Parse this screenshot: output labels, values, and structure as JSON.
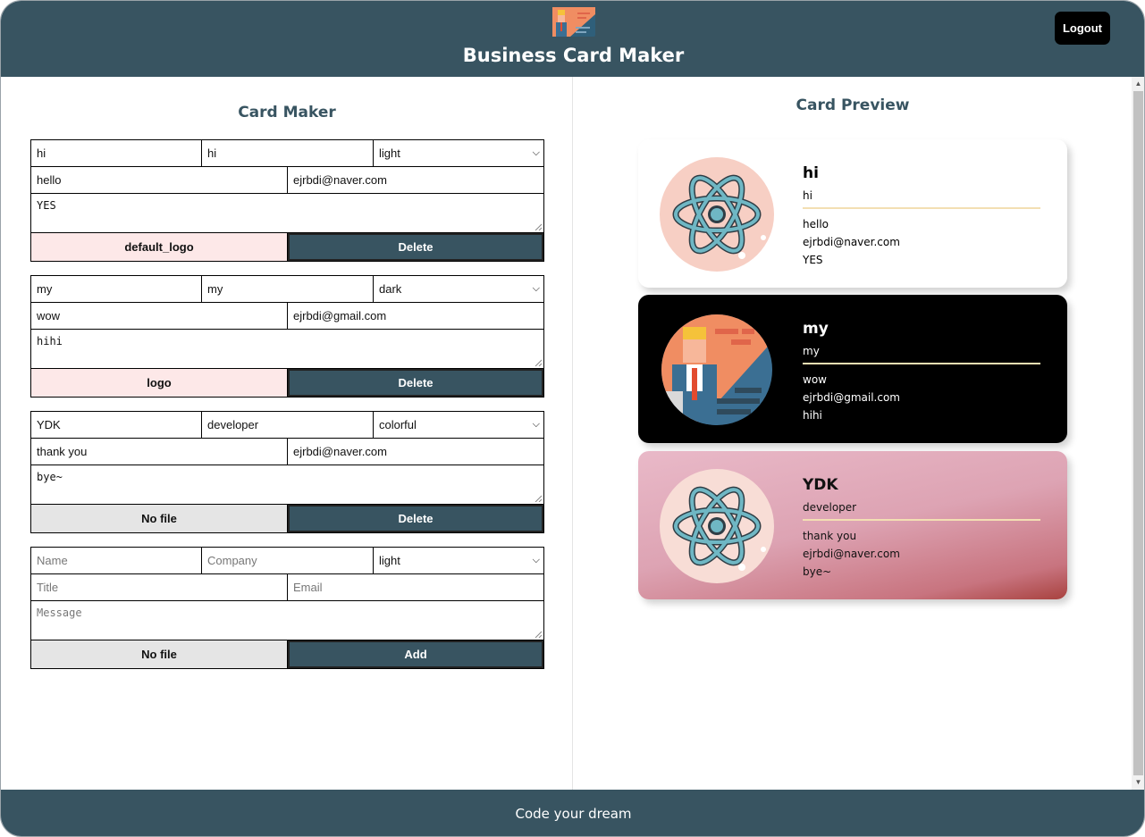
{
  "header": {
    "title": "Business Card Maker",
    "logout_label": "Logout"
  },
  "editor": {
    "title": "Card Maker",
    "forms": [
      {
        "name": "hi",
        "company": "hi",
        "theme": "light",
        "title": "hello",
        "email": "ejrbdi@naver.com",
        "message": "YES",
        "file_label": "default_logo",
        "action_label": "Delete"
      },
      {
        "name": "my",
        "company": "my",
        "theme": "dark",
        "title": "wow",
        "email": "ejrbdi@gmail.com",
        "message": "hihi",
        "file_label": "logo",
        "action_label": "Delete"
      },
      {
        "name": "YDK",
        "company": "developer",
        "theme": "colorful",
        "title": "thank you",
        "email": "ejrbdi@naver.com",
        "message": "bye~",
        "file_label": "No file",
        "action_label": "Delete"
      }
    ],
    "add_form": {
      "name_placeholder": "Name",
      "company_placeholder": "Company",
      "theme": "light",
      "title_placeholder": "Title",
      "email_placeholder": "Email",
      "message_placeholder": "Message",
      "file_label": "No file",
      "action_label": "Add"
    }
  },
  "preview": {
    "title": "Card Preview",
    "cards": [
      {
        "name": "hi",
        "company": "hi",
        "title": "hello",
        "email": "ejrbdi@naver.com",
        "message": "YES",
        "theme": "light",
        "avatar": "react-atom-icon"
      },
      {
        "name": "my",
        "company": "my",
        "title": "wow",
        "email": "ejrbdi@gmail.com",
        "message": "hihi",
        "theme": "dark",
        "avatar": "businessman-icon"
      },
      {
        "name": "YDK",
        "company": "developer",
        "title": "thank you",
        "email": "ejrbdi@naver.com",
        "message": "bye~",
        "theme": "colorful",
        "avatar": "react-atom-icon"
      }
    ]
  },
  "footer": {
    "text": "Code your dream"
  },
  "colors": {
    "primary": "#385461",
    "file_pink": "#fde8e8",
    "file_grey": "#e5e5e5",
    "card_rule": "#f3dfb3"
  }
}
